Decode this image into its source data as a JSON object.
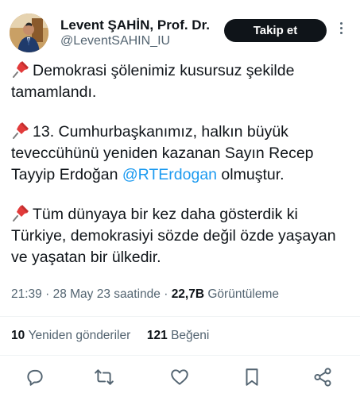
{
  "author": {
    "display_name": "Levent ŞAHİN, Prof. Dr.",
    "handle": "@LeventSAHIN_IU"
  },
  "follow_button": {
    "label": "Takip et"
  },
  "tweet": {
    "paragraphs": [
      {
        "text": "Demokrasi şölenimiz kusursuz şekilde tamamlandı."
      },
      {
        "text_before": "13. Cumhurbaşkanımız, halkın büyük teveccühünü yeniden kazanan Sayın Recep Tayyip Erdoğan ",
        "mention": "@RTErdogan",
        "text_after": " olmuştur."
      },
      {
        "text": "Tüm dünyaya bir kez daha gösterdik ki Türkiye, demokrasiyi sözde değil özde yaşayan ve yaşatan bir ülkedir."
      }
    ],
    "icons": [
      "pushpin-icon"
    ]
  },
  "meta": {
    "time": "21:39",
    "separator": "·",
    "date": "28 May 23 saatinde",
    "views_count": "22,7B",
    "views_label": "Görüntüleme"
  },
  "stats": {
    "retweets_count": "10",
    "retweets_label": "Yeniden gönderiler",
    "likes_count": "121",
    "likes_label": "Beğeni"
  },
  "actions": [
    "reply-icon",
    "retweet-icon",
    "like-icon",
    "bookmark-icon",
    "share-icon"
  ],
  "colors": {
    "text": "#0f1419",
    "secondary": "#536471",
    "link": "#1d9bf0",
    "follow_bg": "#0f1419",
    "pushpin": "#e23b3b"
  }
}
